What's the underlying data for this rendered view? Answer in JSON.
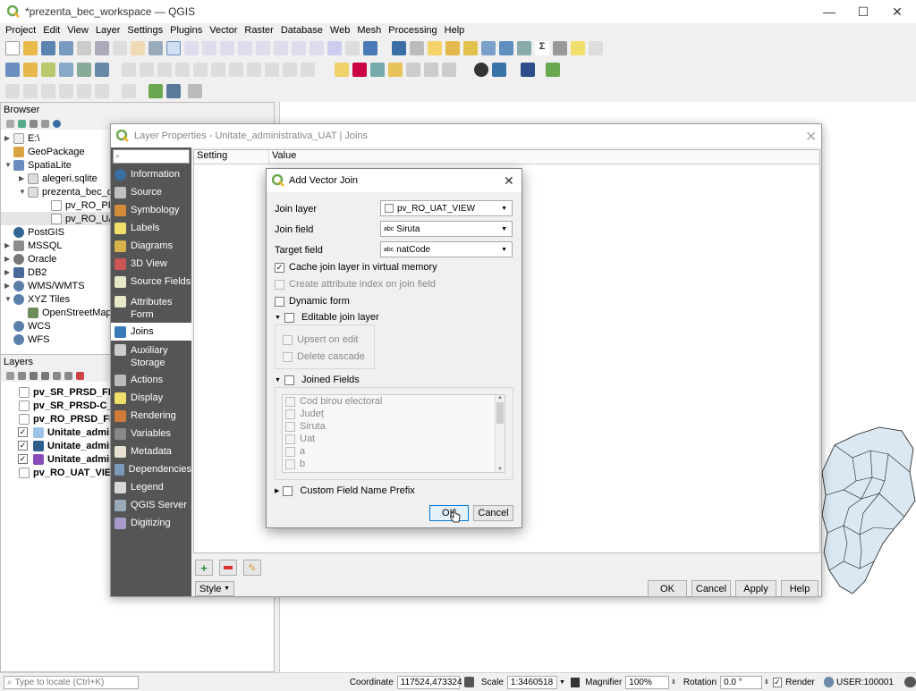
{
  "window": {
    "title": "*prezenta_bec_workspace — QGIS",
    "minimize": "—",
    "maximize": "☐",
    "close": "✕"
  },
  "menu": [
    "Project",
    "Edit",
    "View",
    "Layer",
    "Settings",
    "Plugins",
    "Vector",
    "Raster",
    "Database",
    "Web",
    "Mesh",
    "Processing",
    "Help"
  ],
  "browser": {
    "title": "Browser",
    "items": [
      {
        "label": "E:\\",
        "arrow": "▶"
      },
      {
        "label": "GeoPackage",
        "arrow": ""
      },
      {
        "label": "SpatiaLite",
        "arrow": "▼"
      },
      {
        "label": "alegeri.sqlite",
        "arrow": "▶"
      },
      {
        "label": "prezenta_bec_db",
        "arrow": "▼"
      },
      {
        "label": "pv_RO_PRSD",
        "arrow": ""
      },
      {
        "label": "pv_RO_UAT_",
        "arrow": ""
      },
      {
        "label": "PostGIS",
        "arrow": ""
      },
      {
        "label": "MSSQL",
        "arrow": "▶"
      },
      {
        "label": "Oracle",
        "arrow": "▶"
      },
      {
        "label": "DB2",
        "arrow": "▶"
      },
      {
        "label": "WMS/WMTS",
        "arrow": "▶"
      },
      {
        "label": "XYZ Tiles",
        "arrow": "▼"
      },
      {
        "label": "OpenStreetMap",
        "arrow": ""
      },
      {
        "label": "WCS",
        "arrow": ""
      },
      {
        "label": "WFS",
        "arrow": ""
      }
    ]
  },
  "layers": {
    "title": "Layers",
    "items": [
      {
        "label": "pv_SR_PRSD_FINAL",
        "checked": false,
        "swatch": "table"
      },
      {
        "label": "pv_SR_PRSD-C_FIN",
        "checked": false,
        "swatch": "table"
      },
      {
        "label": "pv_RO_PRSD_FINA",
        "checked": false,
        "swatch": "table"
      },
      {
        "label": "Unitate_adminis",
        "checked": true,
        "swatch": "#9dc3e6"
      },
      {
        "label": "Unitate_adminis",
        "checked": true,
        "swatch": "#2e5e8c"
      },
      {
        "label": "Unitate_adminis",
        "checked": true,
        "swatch": "#8a4bbd"
      },
      {
        "label": "pv_RO_UAT_VIEW",
        "checked": false,
        "swatch": "table"
      }
    ]
  },
  "layer_properties": {
    "title": "Layer Properties - Unitate_administrativa_UAT | Joins",
    "nav": [
      "Information",
      "Source",
      "Symbology",
      "Labels",
      "Diagrams",
      "3D View",
      "Source Fields",
      "Attributes Form",
      "Joins",
      "Auxiliary Storage",
      "Actions",
      "Display",
      "Rendering",
      "Variables",
      "Metadata",
      "Dependencies",
      "Legend",
      "QGIS Server",
      "Digitizing"
    ],
    "selected_nav": "Joins",
    "columns": [
      "Setting",
      "Value"
    ],
    "style_label": "Style",
    "buttons": {
      "ok": "OK",
      "cancel": "Cancel",
      "apply": "Apply",
      "help": "Help"
    }
  },
  "add_vector_join": {
    "title": "Add Vector Join",
    "join_layer_label": "Join layer",
    "join_layer_value": "pv_RO_UAT_VIEW",
    "join_field_label": "Join field",
    "join_field_value": "Siruta",
    "target_field_label": "Target field",
    "target_field_value": "natCode",
    "field_type_tag": "abc",
    "cache_label": "Cache join layer in virtual memory",
    "cache_checked": true,
    "create_index_label": "Create attribute index on join field",
    "dynamic_form_label": "Dynamic form",
    "editable_label": "Editable join layer",
    "upsert_label": "Upsert on edit",
    "delete_cascade_label": "Delete cascade",
    "joined_fields_label": "Joined Fields",
    "joined_fields": [
      "Cod birou electoral",
      "Județ",
      "Siruta",
      "Uat",
      "a",
      "b"
    ],
    "prefix_label": "Custom Field Name Prefix",
    "ok": "OK",
    "cancel": "Cancel"
  },
  "status": {
    "locate_placeholder": "Type to locate (Ctrl+K)",
    "coordinate_label": "Coordinate",
    "coordinate_value": "117524,473324",
    "scale_label": "Scale",
    "scale_value": "1:3460518",
    "magnifier_label": "Magnifier",
    "magnifier_value": "100%",
    "rotation_label": "Rotation",
    "rotation_value": "0.0 °",
    "render_label": "Render",
    "crs_label": "USER:100001"
  },
  "colors": {
    "qgis_green": "#6aa84f",
    "map_fill": "#d9e8f2",
    "nav_bg": "#555555"
  }
}
